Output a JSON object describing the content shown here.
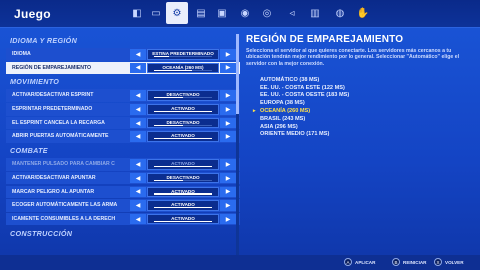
{
  "header": {
    "title": "Juego",
    "tabs": [
      {
        "name": "controller-tab-icon",
        "glyph": "◧"
      },
      {
        "name": "display-tab-icon",
        "glyph": "▭"
      },
      {
        "name": "settings-tab-icon",
        "glyph": "⚙"
      },
      {
        "name": "keyboard-tab-icon",
        "glyph": "▤"
      },
      {
        "name": "window-tab-icon",
        "glyph": "▣"
      },
      {
        "name": "user-tab-icon",
        "glyph": "◉"
      },
      {
        "name": "gamepad-tab-icon",
        "glyph": "◎"
      },
      {
        "name": "audio-tab-icon",
        "glyph": "◃"
      },
      {
        "name": "account-tab-icon",
        "glyph": "▥"
      },
      {
        "name": "controller2-tab-icon",
        "glyph": "◍"
      },
      {
        "name": "touch-tab-icon",
        "glyph": "✋"
      }
    ]
  },
  "left": {
    "sections": [
      {
        "title": "IDIOMA Y REGIÓN",
        "rows": [
          {
            "label": "IDIOMA",
            "value": "ESTINA PREDETERMINADO",
            "progress": 0.25
          },
          {
            "label": "REGIÓN DE EMPAREJAMIENTO",
            "value": "OCEANÍA (260 MS)",
            "progress": 0.65,
            "highlight": true
          }
        ]
      },
      {
        "title": "MOVIMIENTO",
        "rows": [
          {
            "label": "ACTIVAR/DESACTIVAR ESPRINT",
            "value": "DESACTIVADO",
            "progress": 0.5
          },
          {
            "label": "ESPRINTAR PREDETERMINADO",
            "value": "ACTIVADO",
            "progress": 1.0
          },
          {
            "label": "EL ESPRINT CANCELA LA RECARGA",
            "value": "DESACTIVADO",
            "progress": 0.5
          },
          {
            "label": "ABRIR PUERTAS AUTOMÁTICAMENTE",
            "value": "ACTIVADO",
            "progress": 1.0
          }
        ]
      },
      {
        "title": "COMBATE",
        "rows": [
          {
            "label": "MANTENER PULSADO PARA CAMBIAR C",
            "value": "ACTIVADO",
            "progress": 1.0,
            "dim": true
          },
          {
            "label": "ACTIVAR/DESACTIVAR APUNTAR",
            "value": "DESACTIVADO",
            "progress": 0.5
          },
          {
            "label": "MARCAR PELIGRO AL APUNTAR",
            "value": "ACTIVADO",
            "progress": 1.0
          },
          {
            "label": "ECOGER AUTOMÁTICAMENTE LAS ARMA",
            "value": "ACTIVADO",
            "progress": 1.0
          },
          {
            "label": "ICAMENTE CONSUMIBLES A LA DERECH",
            "value": "ACTIVADO",
            "progress": 1.0
          }
        ]
      },
      {
        "title": "CONSTRUCCIÓN",
        "rows": []
      }
    ]
  },
  "right": {
    "title": "REGIÓN DE EMPAREJAMIENTO",
    "description": "Selecciona el servidor al que quieres conectarte. Los servidores más cercanos a tu ubicación tendrán mejor rendimiento por lo general. Seleccionar \"Automático\" elige el servidor con la mejor conexión.",
    "selected_marker": "▸",
    "options": [
      {
        "label": "AUTOMÁTICO (38 MS)",
        "selected": false
      },
      {
        "label": "EE. UU. - COSTA ESTE (122 MS)",
        "selected": false
      },
      {
        "label": "EE. UU. - COSTA OESTE (183 MS)",
        "selected": false
      },
      {
        "label": "EUROPA (38 MS)",
        "selected": false
      },
      {
        "label": "OCEANÍA (260 MS)",
        "selected": true
      },
      {
        "label": "BRASIL (243 MS)",
        "selected": false
      },
      {
        "label": "ASIA (296 MS)",
        "selected": false
      },
      {
        "label": "ORIENTE MEDIO (171 MS)",
        "selected": false
      }
    ]
  },
  "footer": {
    "hints": [
      {
        "button": "A",
        "label": "APLICAR",
        "name": "apply-hint"
      },
      {
        "button": "B",
        "label": "REINICIAR",
        "name": "reset-hint"
      },
      {
        "button": "X",
        "label": "VOLVER",
        "name": "back-hint"
      }
    ]
  },
  "colors": {
    "accent": "#2a6bef",
    "selected_option": "#ffe14a",
    "background": "#1a56d8"
  }
}
